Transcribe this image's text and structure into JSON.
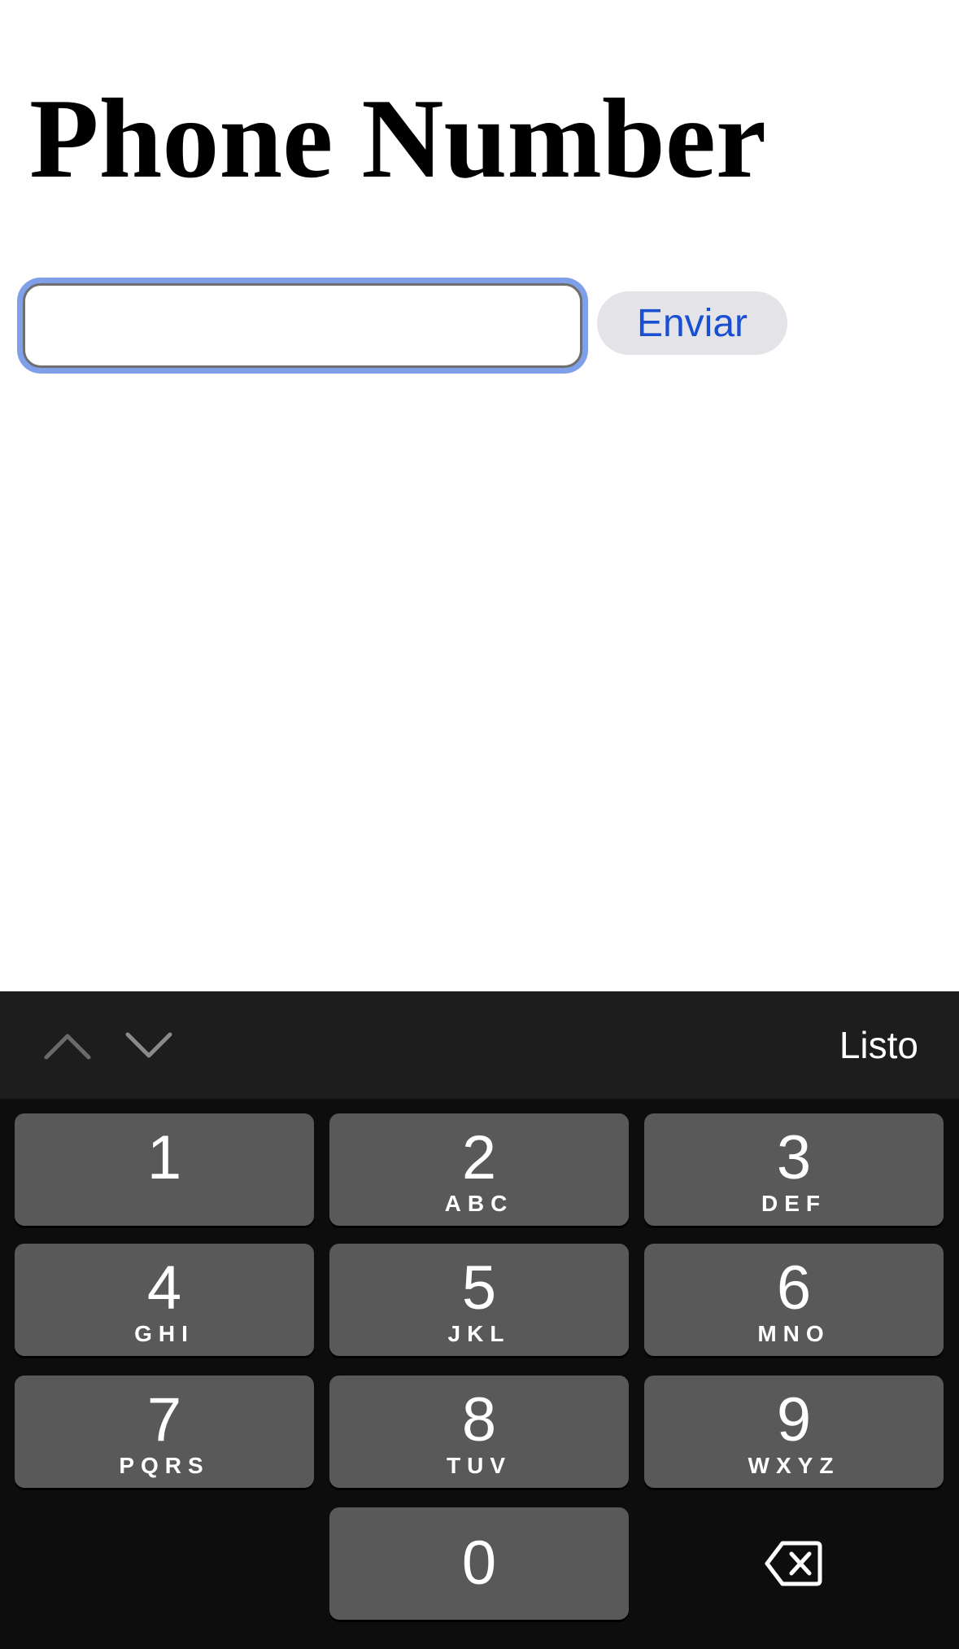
{
  "page": {
    "title": "Phone Number"
  },
  "form": {
    "phone_value": "",
    "submit_label": "Enviar"
  },
  "keyboard": {
    "accessory": {
      "done_label": "Listo",
      "prev_icon": "chevron-up-icon",
      "next_icon": "chevron-down-icon"
    },
    "keys": [
      {
        "digit": "1",
        "letters": ""
      },
      {
        "digit": "2",
        "letters": "ABC"
      },
      {
        "digit": "3",
        "letters": "DEF"
      },
      {
        "digit": "4",
        "letters": "GHI"
      },
      {
        "digit": "5",
        "letters": "JKL"
      },
      {
        "digit": "6",
        "letters": "MNO"
      },
      {
        "digit": "7",
        "letters": "PQRS"
      },
      {
        "digit": "8",
        "letters": "TUV"
      },
      {
        "digit": "9",
        "letters": "WXYZ"
      },
      {
        "digit": "0",
        "letters": ""
      }
    ],
    "delete_icon": "backspace-icon"
  },
  "colors": {
    "focus_ring": "#7f9fe8",
    "button_text": "#1a4fd1",
    "button_bg": "#e3e3e8",
    "keyboard_bg": "#0d0d0d",
    "accessory_bg": "#1d1d1d",
    "key_bg": "#595959"
  }
}
